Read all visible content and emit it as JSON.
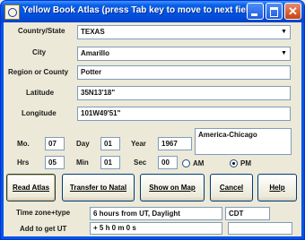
{
  "window": {
    "title": "Yellow Book Atlas (press Tab key to move to next field)",
    "min_symbol": "",
    "max_symbol": "",
    "close_symbol": "✕"
  },
  "form": {
    "country_label": "Country/State",
    "country_value": "TEXAS",
    "city_label": "City",
    "city_value": "Amarillo",
    "region_label": "Region or County",
    "region_value": "Potter",
    "latitude_label": "Latitude",
    "latitude_value": "35N13'18\"",
    "longitude_label": "Longitude",
    "longitude_value": "101W49'51\"",
    "month_label": "Mo.",
    "month_value": "07",
    "day_label": "Day",
    "day_value": "01",
    "year_label": "Year",
    "year_value": "1967",
    "hours_label": "Hrs",
    "hours_value": "05",
    "minutes_label": "Min",
    "minutes_value": "01",
    "seconds_label": "Sec",
    "seconds_value": "00",
    "timezone_name": "America-Chicago",
    "am_label": "AM",
    "pm_label": "PM",
    "am_pm_selected": "PM"
  },
  "buttons": {
    "read_atlas": "Read Atlas",
    "transfer": "Transfer to Natal",
    "show_map": "Show on Map",
    "cancel": "Cancel",
    "help": "Help"
  },
  "footer": {
    "tz_type_label": "Time zone+type",
    "tz_type_value": "6 hours from UT, Daylight",
    "tz_abbrev": "CDT",
    "add_ut_label": "Add to get UT",
    "add_ut_value": "+ 5 h  0 m  0 s",
    "extra_value": ""
  },
  "colors": {
    "titlebar": "#0054e3",
    "dialog_bg": "#ece9d8",
    "field_border": "#7f9db9"
  }
}
